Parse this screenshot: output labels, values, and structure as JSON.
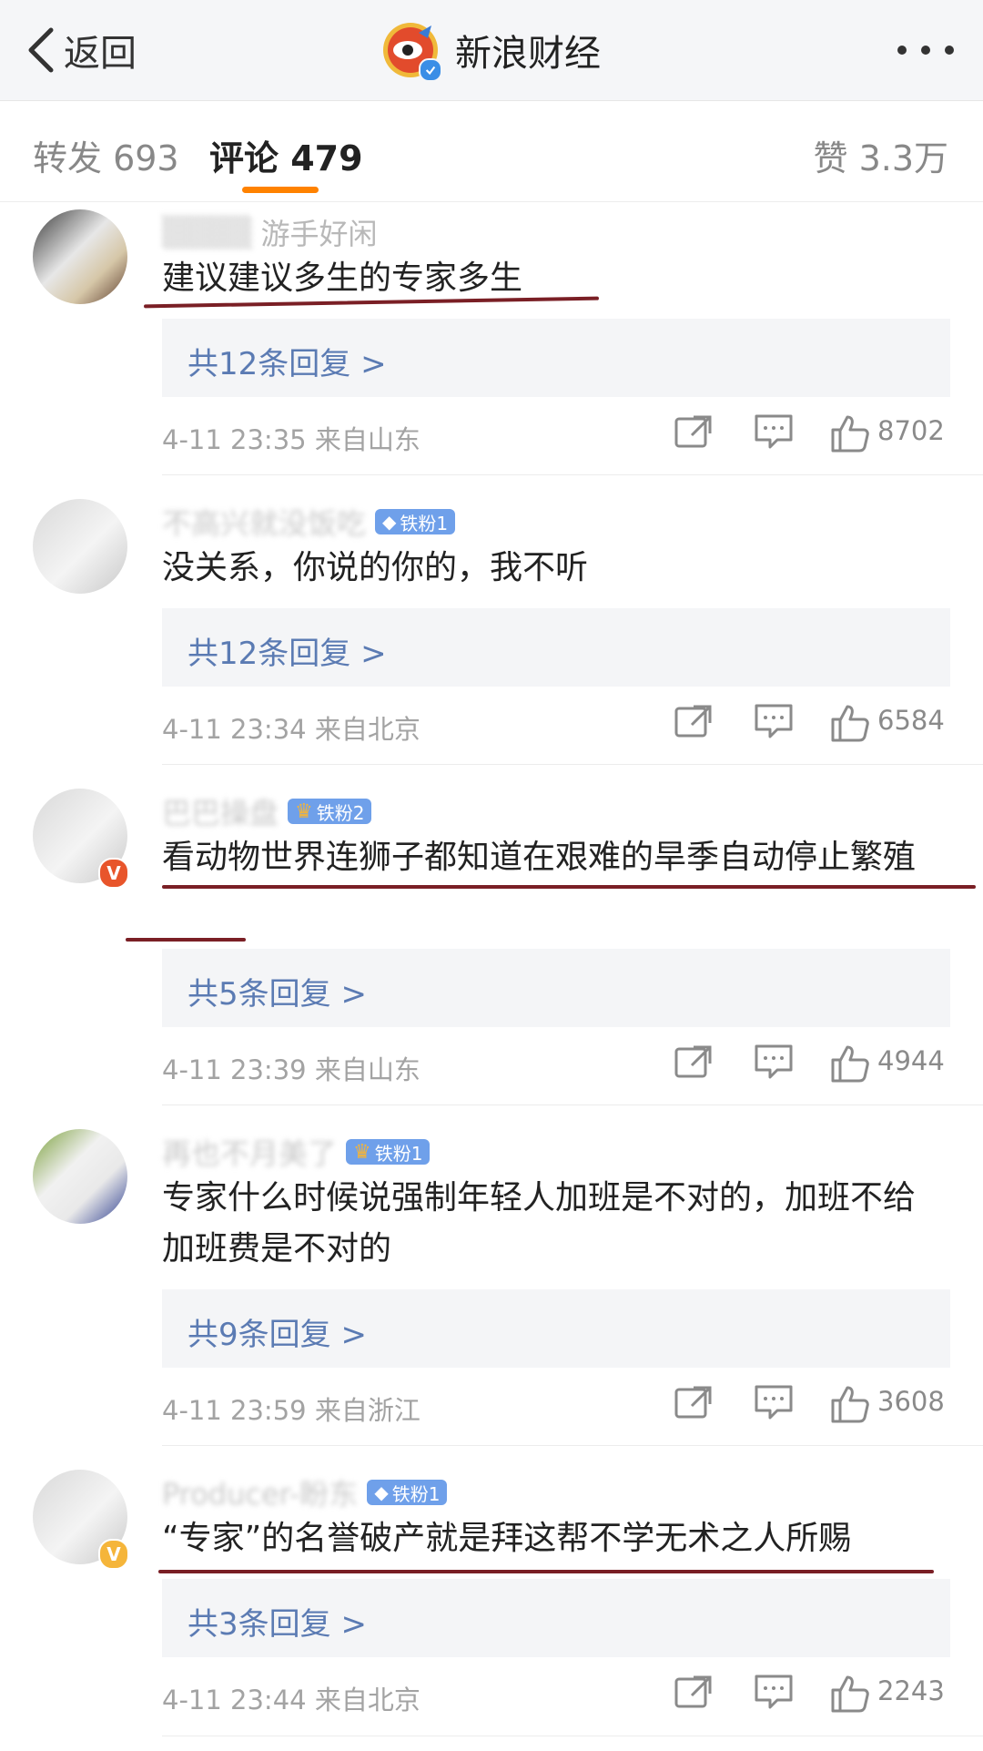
{
  "header": {
    "back_label": "返回",
    "account_name": "新浪财经",
    "more_icon": "more-dots-icon",
    "verified_icon": "verified-check-icon"
  },
  "tabs": {
    "repost": "转发 693",
    "comment": "评论 479",
    "like": "赞 3.3万"
  },
  "colors": {
    "accent": "#ff8200",
    "reply_link": "#5b7bb3",
    "underline_mark": "#7a1f25",
    "fan_badge": "#6fa0ea"
  },
  "comments": [
    {
      "username": "游手好闲",
      "username_blurred_prefix": "",
      "fan_badge": "",
      "verified": "",
      "text": "建议建议多生的专家多生",
      "reply_label": "共12条回复 >",
      "time": "4-11 23:35",
      "source": "来自山东",
      "likes": "8702"
    },
    {
      "username": "不高兴就没饭吃",
      "fan_badge": "铁粉1",
      "verified": "",
      "text": "没关系，你说的你的，我不听",
      "reply_label": "共12条回复 >",
      "time": "4-11 23:34",
      "source": "来自北京",
      "likes": "6584"
    },
    {
      "username": "巴巴操盘",
      "fan_badge": "铁粉2",
      "verified": "V",
      "text": "看动物世界连狮子都知道在艰难的旱季自动停止繁殖",
      "reply_label": "共5条回复 >",
      "time": "4-11 23:39",
      "source": "来自山东",
      "likes": "4944"
    },
    {
      "username": "再也不月美了",
      "fan_badge": "铁粉1",
      "verified": "",
      "text": "专家什么时候说强制年轻人加班是不对的，加班不给加班费是不对的",
      "reply_label": "共9条回复 >",
      "time": "4-11 23:59",
      "source": "来自浙江",
      "likes": "3608"
    },
    {
      "username": "Producer-盼东",
      "fan_badge": "铁粉1",
      "verified": "V",
      "text": "“专家”的名誉破产就是拜这帮不学无术之人所赐",
      "reply_label": "共3条回复 >",
      "time": "4-11 23:44",
      "source": "来自北京",
      "likes": "2243"
    }
  ]
}
